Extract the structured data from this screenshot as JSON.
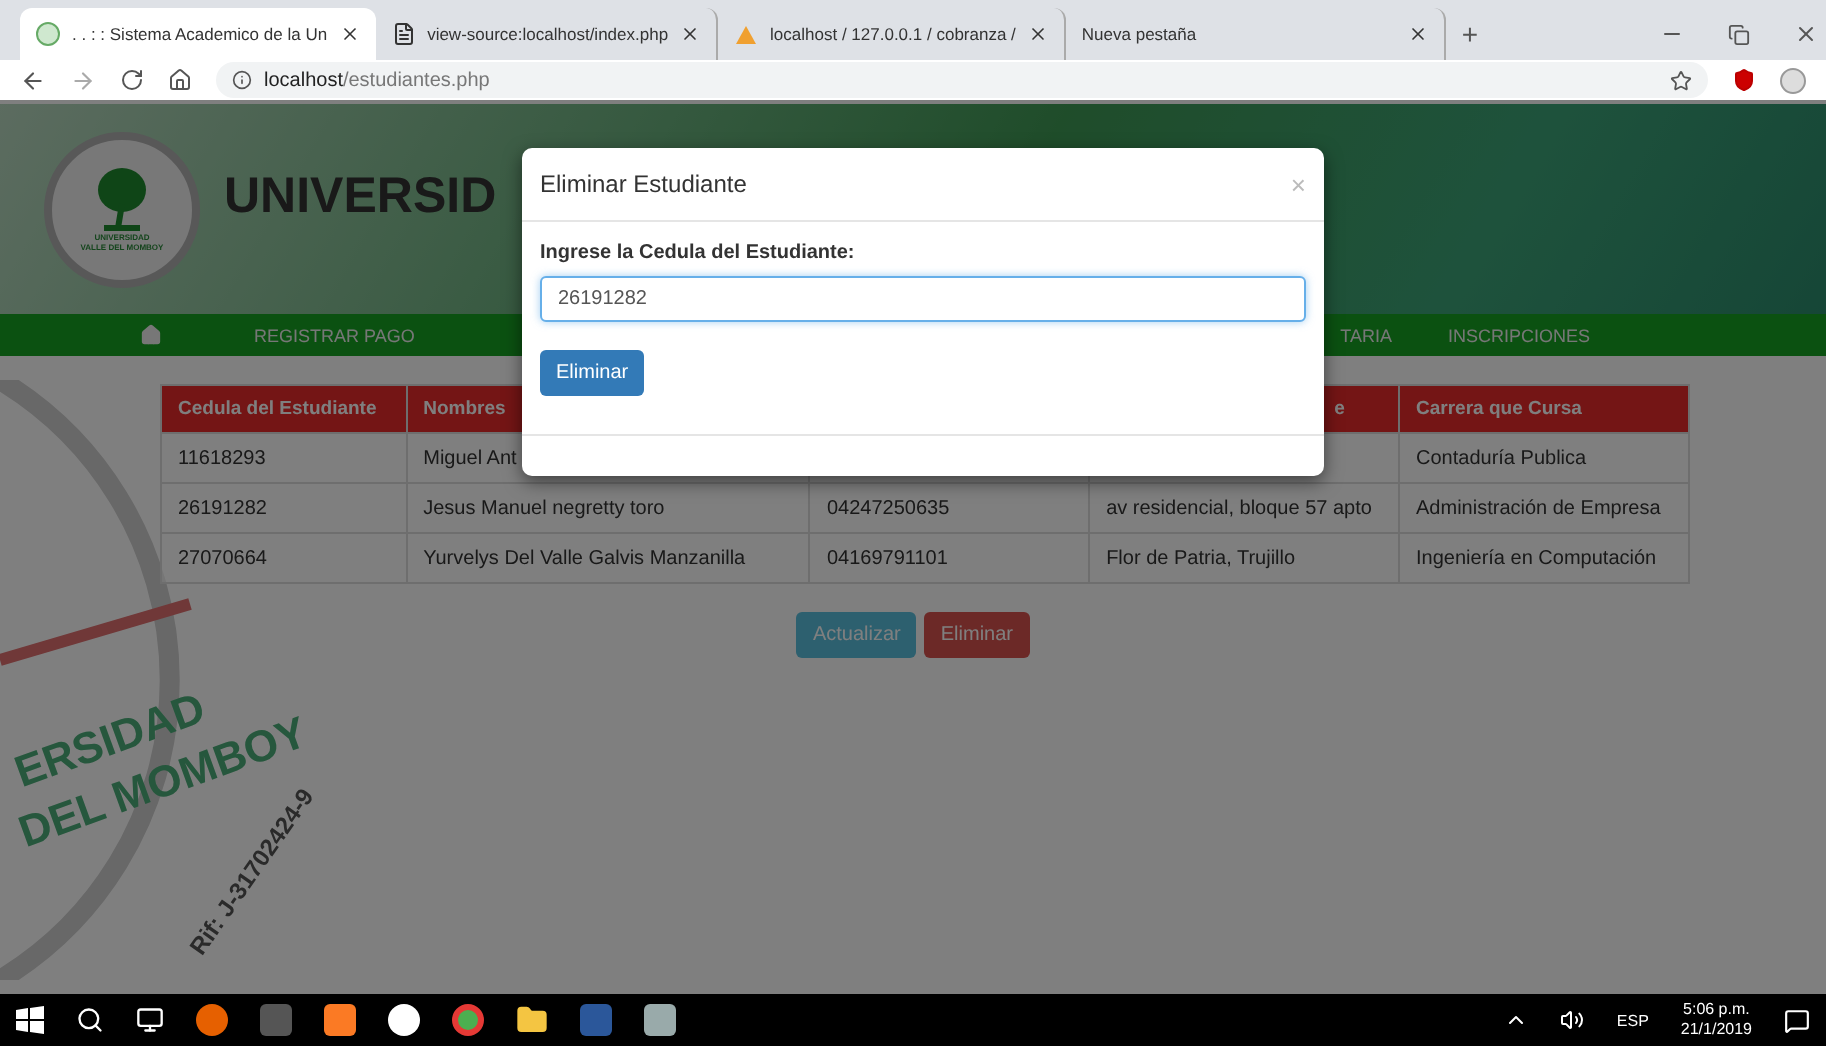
{
  "browser": {
    "tabs": [
      {
        "title": ". . : : Sistema Academico de la Un",
        "kind": "logo",
        "selected": true
      },
      {
        "title": "view-source:localhost/index.php",
        "kind": "page",
        "selected": false
      },
      {
        "title": "localhost / 127.0.0.1 / cobranza /",
        "kind": "db",
        "selected": false
      },
      {
        "title": "Nueva pestaña",
        "selected": false
      }
    ],
    "new_tab": "+",
    "host": "localhost",
    "path": "/estudiantes.php"
  },
  "header": {
    "logo_text": [
      "UNIVERSIDAD",
      "VALLE DEL MOMBOY"
    ],
    "title": "UNIVERSID"
  },
  "nav": {
    "left": [
      "REGISTRAR PAGO"
    ],
    "right": [
      "TARIA",
      "INSCRIPCIONES"
    ]
  },
  "watermark": {
    "texts": [
      "ERSIDAD",
      "DEL MOMBOY",
      "Rif: J-31702424-9"
    ]
  },
  "table": {
    "columns": [
      "Cedula del Estudiante",
      "Nombres",
      "",
      "e",
      "Carrera que Cursa"
    ],
    "rows": [
      [
        "11618293",
        "Miguel Ant",
        "",
        "",
        "Contaduría Publica"
      ],
      [
        "26191282",
        "Jesus Manuel negretty toro",
        "04247250635",
        "av residencial, bloque 57 apto",
        "Administración de Empresa"
      ],
      [
        "27070664",
        "Yurvelys Del Valle Galvis Manzanilla",
        "04169791101",
        "Flor de Patria, Trujillo",
        "Ingeniería en Computación"
      ]
    ]
  },
  "actions": [
    {
      "label": "Actualizar",
      "kind": "info"
    },
    {
      "label": "Eliminar",
      "kind": "danger"
    }
  ],
  "modal": {
    "title": "Eliminar Estudiante",
    "close": "×",
    "label": "Ingrese la Cedula del Estudiante:",
    "value": "26191282",
    "button": "Eliminar"
  },
  "taskbar": {
    "language": "ESP",
    "time": "5:06 p.m.",
    "date": "21/1/2019"
  }
}
